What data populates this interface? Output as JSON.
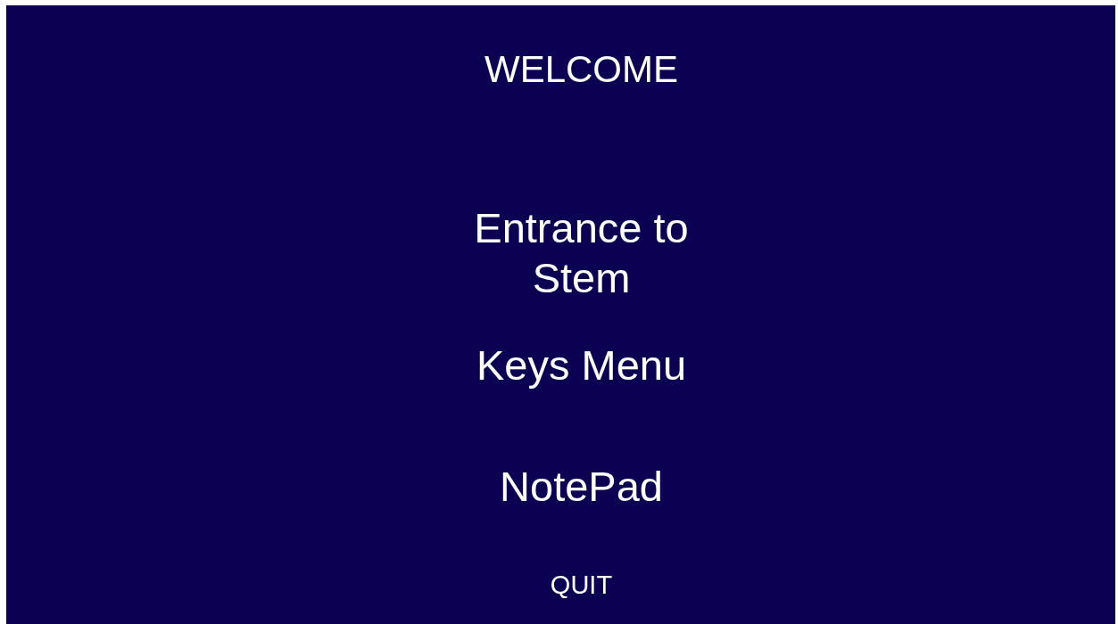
{
  "title": "WELCOME",
  "menu_items": [
    {
      "label": "Entrance to Stem",
      "kind": "large"
    },
    {
      "label": "Keys Menu",
      "kind": "large"
    },
    {
      "label": "NotePad",
      "kind": "large"
    },
    {
      "label": "QUIT",
      "kind": "small"
    }
  ]
}
